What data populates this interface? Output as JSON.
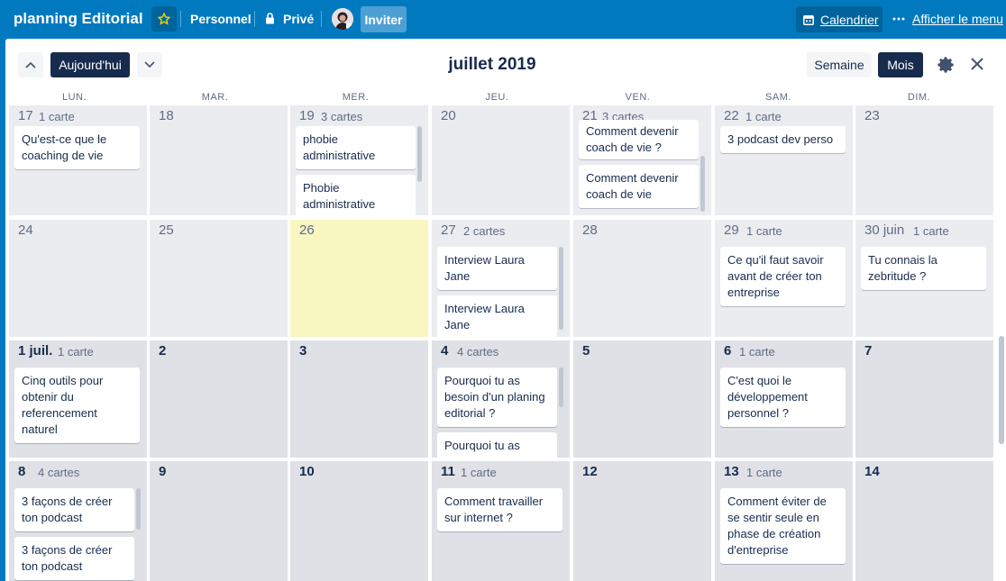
{
  "header": {
    "board_title": "planning Editorial",
    "personal": "Personnel",
    "private": "Privé",
    "invite": "Inviter",
    "calendar": "Calendrier",
    "menu": "Afficher le menu"
  },
  "toolbar": {
    "today": "Aujourd'hui",
    "month_title": "juillet 2019",
    "week": "Semaine",
    "month": "Mois"
  },
  "weekdays": [
    "LUN.",
    "MAR.",
    "MER.",
    "JEU.",
    "VEN.",
    "SAM.",
    "DIM."
  ],
  "cells": {
    "r0c0": {
      "day": "17",
      "count": "1 carte",
      "cards": [
        "Qu'est-ce que le coaching de vie"
      ]
    },
    "r0c1": {
      "day": "18"
    },
    "r0c2": {
      "day": "19",
      "count": "3 cartes",
      "cards": [
        "phobie administrative",
        "Phobie administrative"
      ]
    },
    "r0c3": {
      "day": "20"
    },
    "r0c4": {
      "day": "21",
      "count": "3 cartes",
      "cards": [
        "Comment devenir coach de vie ?",
        "Comment devenir coach de vie"
      ]
    },
    "r0c5": {
      "day": "22",
      "count": "1 carte",
      "cards": [
        "3 podcast dev perso"
      ]
    },
    "r0c6": {
      "day": "23"
    },
    "r1c0": {
      "day": "24"
    },
    "r1c1": {
      "day": "25"
    },
    "r1c2": {
      "day": "26"
    },
    "r1c3": {
      "day": "27",
      "count": "2 cartes",
      "cards": [
        "Interview Laura Jane",
        "Interview Laura Jane"
      ]
    },
    "r1c4": {
      "day": "28"
    },
    "r1c5": {
      "day": "29",
      "count": "1 carte",
      "cards": [
        "Ce qu'il faut savoir avant de créer ton entreprise"
      ]
    },
    "r1c6": {
      "day": "30 juin",
      "count": "1 carte",
      "cards": [
        "Tu connais la zebritude ?"
      ]
    },
    "r2c0": {
      "day": "1 juil.",
      "count": "1 carte",
      "cards": [
        "Cinq outils pour obtenir du referencement naturel"
      ]
    },
    "r2c1": {
      "day": "2"
    },
    "r2c2": {
      "day": "3"
    },
    "r2c3": {
      "day": "4",
      "count": "4 cartes",
      "cards": [
        "Pourquoi tu as besoin d'un planing editorial ?",
        "Pourquoi tu as"
      ]
    },
    "r2c4": {
      "day": "5"
    },
    "r2c5": {
      "day": "6",
      "count": "1 carte",
      "cards": [
        "C'est quoi le développement personnel ?"
      ]
    },
    "r2c6": {
      "day": "7"
    },
    "r3c0": {
      "day": "8",
      "count": "4 cartes",
      "cards": [
        "3 façons de créer ton podcast",
        "3 façons de créer ton podcast"
      ]
    },
    "r3c1": {
      "day": "9"
    },
    "r3c2": {
      "day": "10"
    },
    "r3c3": {
      "day": "11",
      "count": "1 carte",
      "cards": [
        "Comment travailler sur internet ?"
      ]
    },
    "r3c4": {
      "day": "12"
    },
    "r3c5": {
      "day": "13",
      "count": "1 carte",
      "cards": [
        "Comment éviter de se sentir seule en phase de création d'entreprise"
      ]
    },
    "r3c6": {
      "day": "14"
    }
  },
  "colors": {
    "brand": "#0079bf",
    "today_bg": "#f8f6c1",
    "dark": "#172b4d"
  }
}
